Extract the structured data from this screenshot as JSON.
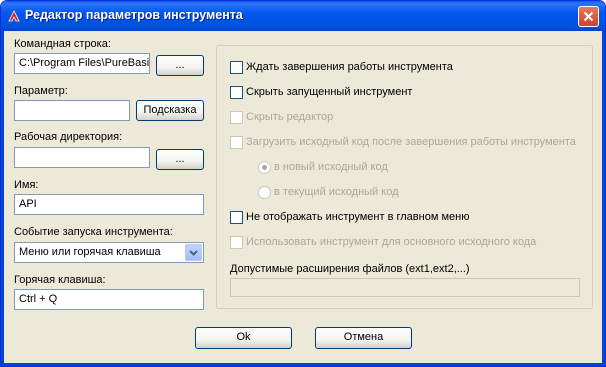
{
  "window": {
    "title": "Редактор параметров инструмента",
    "close_label": "×"
  },
  "left": {
    "cmd_label": "Командная строка:",
    "cmd_value": "C:\\Program Files\\PureBasi",
    "cmd_browse": "...",
    "param_label": "Параметр:",
    "param_value": "",
    "hint_button": "Подсказка",
    "workdir_label": "Рабочая директория:",
    "workdir_value": "",
    "workdir_browse": "...",
    "name_label": "Имя:",
    "name_value": "API",
    "event_label": "Событие запуска инструмента:",
    "event_value": "Меню или горячая клавиша",
    "hotkey_label": "Горячая клавиша:",
    "hotkey_value": "Ctrl + Q"
  },
  "options": {
    "wait": "Ждать завершения работы инструмента",
    "hide_running": "Скрыть запущенный инструмент",
    "hide_editor": "Скрыть редактор",
    "reload_source": "Загрузить исходный код после завершения работы инструмента",
    "radio_new": "в новый исходный код",
    "radio_current": "в текущий исходный код",
    "no_menu": "Не отображать инструмент в главном меню",
    "main_source": "Использовать инструмент для основного исходного кода",
    "extensions_label": "Допустимые расширения файлов (ext1,ext2,...)",
    "extensions_value": ""
  },
  "footer": {
    "ok": "Ok",
    "cancel": "Отмена"
  },
  "colors": {
    "title_bar": "#0058ee",
    "face": "#ece9d8",
    "disabled_text": "#aca899"
  }
}
